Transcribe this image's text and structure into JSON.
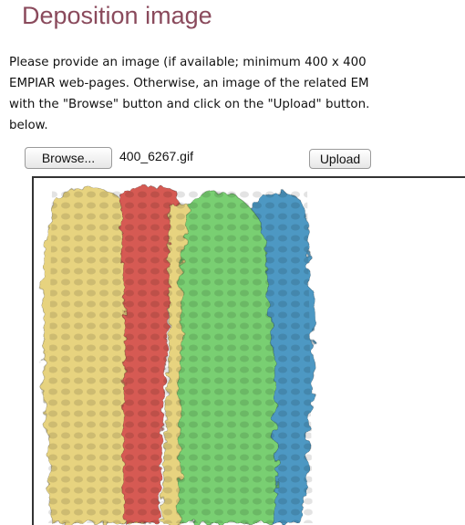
{
  "section": {
    "title": "Deposition image"
  },
  "description": {
    "lines": [
      "Please provide an image (if available; minimum 400 x 400",
      "EMPIAR web-pages. Otherwise, an image of the related EM",
      "with the \"Browse\" button and click on the \"Upload\" button.",
      "below."
    ]
  },
  "file_input": {
    "browse_label": "Browse...",
    "file_name": "400_6267.gif"
  },
  "upload": {
    "label": "Upload"
  },
  "preview": {
    "colors": {
      "yellow": "#e7d37f",
      "red": "#d65a52",
      "green": "#79cf72",
      "blue": "#4d98c3"
    }
  }
}
